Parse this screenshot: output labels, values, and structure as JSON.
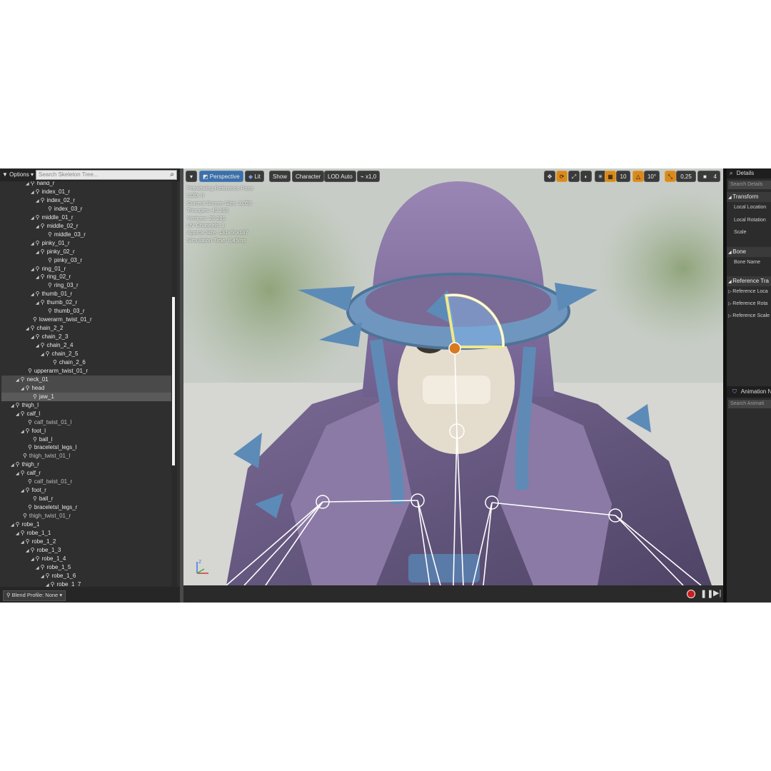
{
  "skeleton_tree": {
    "options_label": "Options",
    "search_placeholder": "Search Skeleton Tree...",
    "scroll_position": 0.33,
    "rows": [
      {
        "label": "hand_r",
        "indent": 4,
        "arrow": true
      },
      {
        "label": "index_01_r",
        "indent": 5,
        "arrow": true
      },
      {
        "label": "index_02_r",
        "indent": 6,
        "arrow": true
      },
      {
        "label": "index_03_r",
        "indent": 7,
        "arrow": false
      },
      {
        "label": "middle_01_r",
        "indent": 5,
        "arrow": true
      },
      {
        "label": "middle_02_r",
        "indent": 6,
        "arrow": true
      },
      {
        "label": "middle_03_r",
        "indent": 7,
        "arrow": false
      },
      {
        "label": "pinky_01_r",
        "indent": 5,
        "arrow": true
      },
      {
        "label": "pinky_02_r",
        "indent": 6,
        "arrow": true
      },
      {
        "label": "pinky_03_r",
        "indent": 7,
        "arrow": false
      },
      {
        "label": "ring_01_r",
        "indent": 5,
        "arrow": true
      },
      {
        "label": "ring_02_r",
        "indent": 6,
        "arrow": true
      },
      {
        "label": "ring_03_r",
        "indent": 7,
        "arrow": false
      },
      {
        "label": "thumb_01_r",
        "indent": 5,
        "arrow": true
      },
      {
        "label": "thumb_02_r",
        "indent": 6,
        "arrow": true
      },
      {
        "label": "thumb_03_r",
        "indent": 7,
        "arrow": false
      },
      {
        "label": "lowerarm_twist_01_r",
        "indent": 4,
        "arrow": false
      },
      {
        "label": "chain_2_2",
        "indent": 4,
        "arrow": true
      },
      {
        "label": "chain_2_3",
        "indent": 5,
        "arrow": true
      },
      {
        "label": "chain_2_4",
        "indent": 6,
        "arrow": true
      },
      {
        "label": "chain_2_5",
        "indent": 7,
        "arrow": true
      },
      {
        "label": "chain_2_6",
        "indent": 8,
        "arrow": false
      },
      {
        "label": "upperarm_twist_01_r",
        "indent": 3,
        "arrow": false
      },
      {
        "label": "neck_01",
        "indent": 2,
        "arrow": true,
        "state": "hl"
      },
      {
        "label": "head",
        "indent": 3,
        "arrow": true,
        "state": "hl"
      },
      {
        "label": "jaw_1",
        "indent": 4,
        "arrow": false,
        "state": "sel"
      },
      {
        "label": "thigh_l",
        "indent": 1,
        "arrow": true
      },
      {
        "label": "calf_l",
        "indent": 2,
        "arrow": true
      },
      {
        "label": "calf_twist_01_l",
        "indent": 3,
        "arrow": false,
        "dim": true
      },
      {
        "label": "foot_l",
        "indent": 3,
        "arrow": true
      },
      {
        "label": "ball_l",
        "indent": 4,
        "arrow": false
      },
      {
        "label": "braceletsl_legs_l",
        "indent": 3,
        "arrow": false
      },
      {
        "label": "thigh_twist_01_l",
        "indent": 2,
        "arrow": false,
        "dim": true
      },
      {
        "label": "thigh_r",
        "indent": 1,
        "arrow": true
      },
      {
        "label": "calf_r",
        "indent": 2,
        "arrow": true
      },
      {
        "label": "calf_twist_01_r",
        "indent": 3,
        "arrow": false,
        "dim": true
      },
      {
        "label": "foot_r",
        "indent": 3,
        "arrow": true
      },
      {
        "label": "ball_r",
        "indent": 4,
        "arrow": false
      },
      {
        "label": "braceletsl_legs_r",
        "indent": 3,
        "arrow": false
      },
      {
        "label": "thigh_twist_01_r",
        "indent": 2,
        "arrow": false,
        "dim": true
      },
      {
        "label": "robe_1",
        "indent": 1,
        "arrow": true
      },
      {
        "label": "robe_1_1",
        "indent": 2,
        "arrow": true
      },
      {
        "label": "robe_1_2",
        "indent": 3,
        "arrow": true
      },
      {
        "label": "robe_1_3",
        "indent": 4,
        "arrow": true
      },
      {
        "label": "robe_1_4",
        "indent": 5,
        "arrow": true
      },
      {
        "label": "robe_1_5",
        "indent": 6,
        "arrow": true
      },
      {
        "label": "robe_1_6",
        "indent": 7,
        "arrow": true
      },
      {
        "label": "robe_1_7",
        "indent": 8,
        "arrow": true
      }
    ],
    "blend_profile_label": "Blend Profile: None"
  },
  "viewport": {
    "toolbar": {
      "dropdown_glyph": "▾",
      "perspective": "Perspective",
      "lit": "Lit",
      "show": "Show",
      "character": "Character",
      "lod": "LOD Auto",
      "speed": "x1,0",
      "grid_snap": "10",
      "rotation_snap": "10°",
      "scale_snap": "0,25",
      "camera_speed": "4"
    },
    "stats": [
      "Previewing Reference Pose",
      "LOD: 0",
      "Current Screen Size: 3,055",
      "Triangles: 45 260",
      "Vertices: 28 281",
      "UV Channels: 1",
      "Approx Size: 131x66x187",
      "Simulation Time: 0,45ms"
    ]
  },
  "details": {
    "tab_label": "Details",
    "search_placeholder": "Search Details",
    "sections": [
      {
        "title": "Transform",
        "rows": [
          "Local Location",
          "Local Rotation",
          "Scale"
        ]
      },
      {
        "title": "Bone",
        "rows": [
          "Bone Name"
        ]
      },
      {
        "title": "Reference Tra",
        "rows": [
          "Reference Loca",
          "Reference Rota",
          "Reference Scale"
        ]
      }
    ],
    "anim_tab_label": "Animation N",
    "anim_search_placeholder": "Search Animati"
  },
  "colors": {
    "accent_blue": "#3d6fa8",
    "snap_orange": "#d98a1e",
    "record_red": "#c91f1f"
  }
}
